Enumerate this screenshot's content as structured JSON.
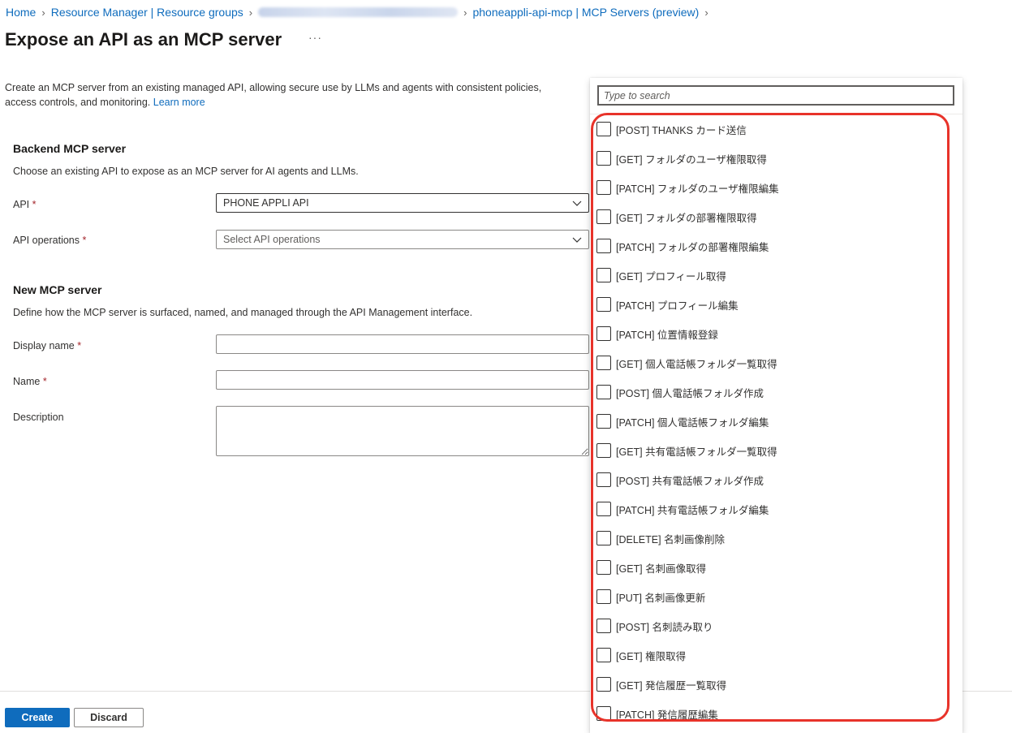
{
  "breadcrumb": {
    "home": "Home",
    "resource_groups": "Resource Manager | Resource groups",
    "mcp_servers": "phoneappli-api-mcp | MCP Servers (preview)"
  },
  "page": {
    "title": "Expose an API as an MCP server",
    "more": "···",
    "intro": "Create an MCP server from an existing managed API, allowing secure use by LLMs and agents with consistent policies, access controls, and monitoring.",
    "learn_more": "Learn more"
  },
  "backend": {
    "heading": "Backend MCP server",
    "description": "Choose an existing API to expose as an MCP server for AI agents and LLMs.",
    "api_label": "API",
    "api_value": "PHONE APPLI API",
    "ops_label": "API operations",
    "ops_placeholder": "Select API operations",
    "required_mark": "*"
  },
  "new_server": {
    "heading": "New MCP server",
    "description": "Define how the MCP server is surfaced, named, and managed through the API Management interface.",
    "display_name_label": "Display name",
    "name_label": "Name",
    "description_label": "Description"
  },
  "footer": {
    "create": "Create",
    "discard": "Discard"
  },
  "dropdown": {
    "search_placeholder": "Type to search",
    "highlight_color": "#e8332a",
    "operations": [
      "[POST] THANKS カード送信",
      "[GET] フォルダのユーザ権限取得",
      "[PATCH] フォルダのユーザ権限編集",
      "[GET] フォルダの部署権限取得",
      "[PATCH] フォルダの部署権限編集",
      "[GET] プロフィール取得",
      "[PATCH] プロフィール編集",
      "[PATCH] 位置情報登録",
      "[GET] 個人電話帳フォルダ一覧取得",
      "[POST] 個人電話帳フォルダ作成",
      "[PATCH] 個人電話帳フォルダ編集",
      "[GET] 共有電話帳フォルダ一覧取得",
      "[POST] 共有電話帳フォルダ作成",
      "[PATCH] 共有電話帳フォルダ編集",
      "[DELETE] 名刺画像削除",
      "[GET] 名刺画像取得",
      "[PUT] 名刺画像更新",
      "[POST] 名刺読み取り",
      "[GET] 権限取得",
      "[GET] 発信履歴一覧取得",
      "[PATCH] 発信履歴編集"
    ]
  }
}
